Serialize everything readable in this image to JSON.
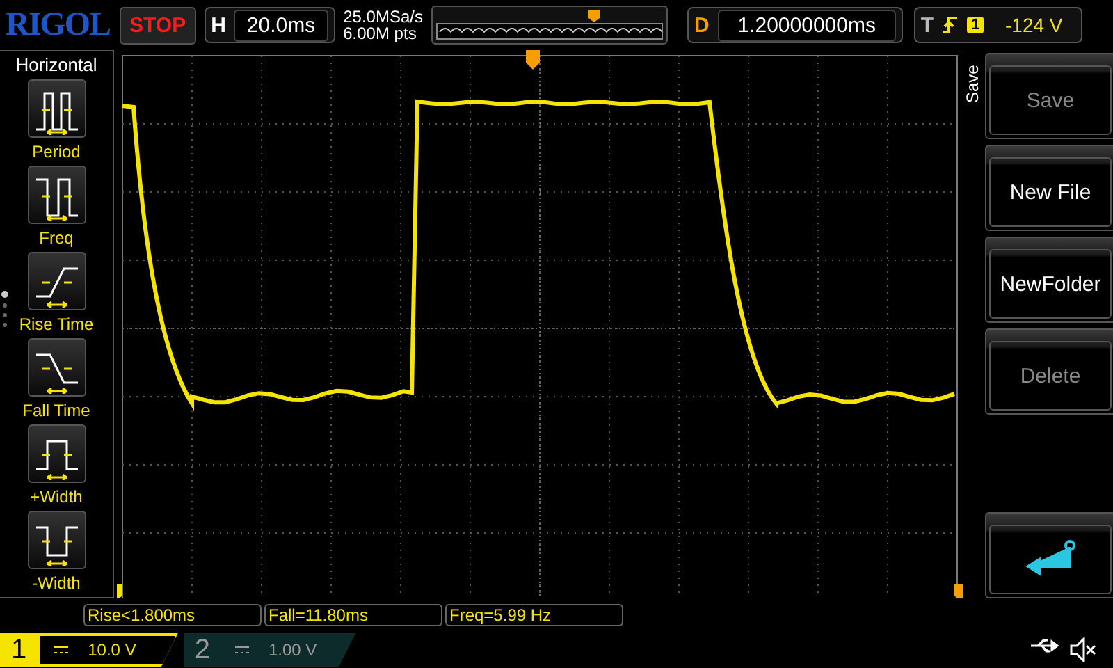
{
  "header": {
    "logo": "RIGOL",
    "run_state": "STOP",
    "horizontal": {
      "label": "H",
      "timebase": "20.0ms"
    },
    "sample_rate": "25.0MSa/s",
    "memory_depth": "6.00M pts",
    "delay": {
      "label": "D",
      "value": "1.20000000ms"
    },
    "trigger": {
      "label": "T",
      "source": "1",
      "level": "-124 V"
    }
  },
  "measure_menu": {
    "title": "Horizontal",
    "items": [
      {
        "label": "Period",
        "kind": "period"
      },
      {
        "label": "Freq",
        "kind": "freq"
      },
      {
        "label": "Rise Time",
        "kind": "rise"
      },
      {
        "label": "Fall Time",
        "kind": "fall"
      },
      {
        "label": "+Width",
        "kind": "pwidth"
      },
      {
        "label": "-Width",
        "kind": "nwidth"
      }
    ],
    "page_dots": [
      {
        "selected": true
      },
      {
        "selected": false
      },
      {
        "selected": false
      },
      {
        "selected": false
      }
    ]
  },
  "softkeys": {
    "title": "Save",
    "keys": [
      {
        "kind": "text",
        "label": "Save",
        "disabled": true
      },
      {
        "kind": "text",
        "label": "New File",
        "disabled": false
      },
      {
        "kind": "text",
        "label": "NewFolder",
        "disabled": false
      },
      {
        "kind": "text",
        "label": "Delete",
        "disabled": true
      },
      {
        "kind": "gap"
      },
      {
        "kind": "back"
      }
    ]
  },
  "measurements": [
    {
      "text": "Rise<1.800ms"
    },
    {
      "text": "Fall=11.80ms"
    },
    {
      "text": "Freq=5.99 Hz"
    }
  ],
  "channels": [
    {
      "number": "1",
      "scale": "10.0 V",
      "selected": true
    },
    {
      "number": "2",
      "scale": "1.00 V",
      "selected": false
    }
  ]
}
